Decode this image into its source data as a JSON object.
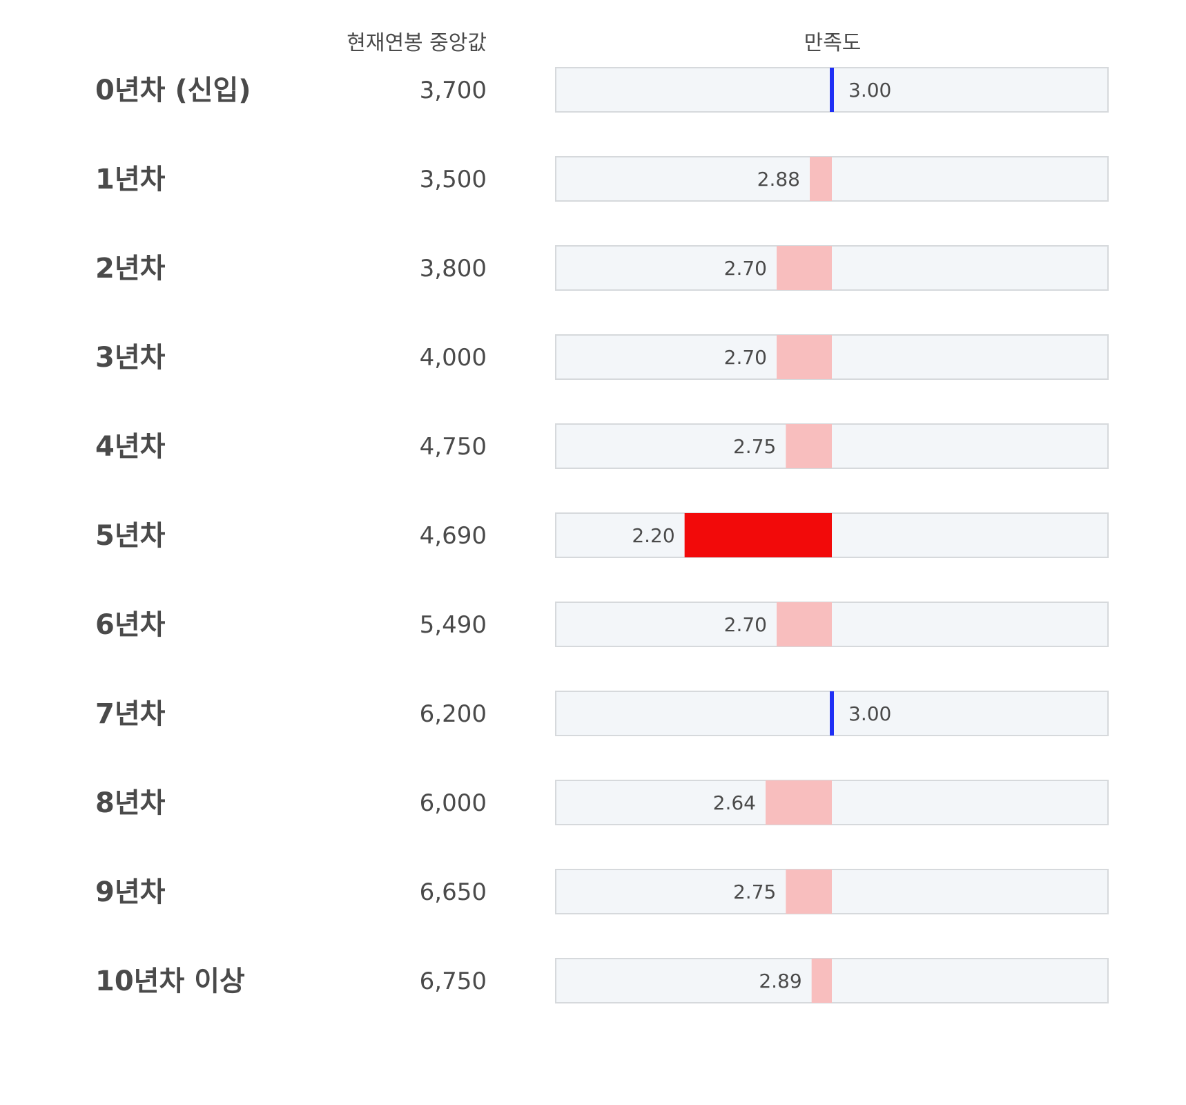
{
  "chart_data": {
    "type": "bar",
    "headers": {
      "salary": "현재연봉 중앙값",
      "satisfaction": "만족도"
    },
    "categories": [
      "0년차 (신입)",
      "1년차",
      "2년차",
      "3년차",
      "4년차",
      "5년차",
      "6년차",
      "7년차",
      "8년차",
      "9년차",
      "10년차 이상"
    ],
    "salary_median": [
      "3,700",
      "3,500",
      "3,800",
      "4,000",
      "4,750",
      "4,690",
      "5,490",
      "6,200",
      "6,000",
      "6,650",
      "6,750"
    ],
    "satisfaction": [
      3.0,
      2.88,
      2.7,
      2.7,
      2.75,
      2.2,
      2.7,
      3.0,
      2.64,
      2.75,
      2.89
    ],
    "satisfaction_labels": [
      "3.00",
      "2.88",
      "2.70",
      "2.70",
      "2.75",
      "2.20",
      "2.70",
      "3.00",
      "2.64",
      "2.75",
      "2.89"
    ],
    "baseline": 3.0,
    "xlim": [
      1.5,
      4.5
    ],
    "colors": {
      "neutral": "#1f2ff5",
      "below_light": "#f8bebe",
      "below_strong": "#f20a0a",
      "track": "#f3f6f9",
      "track_border": "#d6d9dc",
      "text": "#4a4a4a"
    }
  }
}
